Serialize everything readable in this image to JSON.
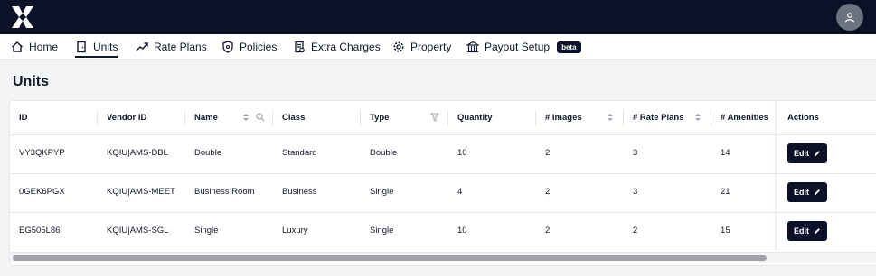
{
  "nav": {
    "items": [
      {
        "label": "Home",
        "icon": "home-icon"
      },
      {
        "label": "Units",
        "icon": "door-icon",
        "active": true
      },
      {
        "label": "Rate Plans",
        "icon": "trend-icon"
      },
      {
        "label": "Policies",
        "icon": "shield-icon"
      },
      {
        "label": "Extra Charges",
        "icon": "invoice-icon"
      },
      {
        "label": "Property",
        "icon": "gear-icon"
      },
      {
        "label": "Payout Setup",
        "icon": "bank-icon",
        "badge": "beta"
      }
    ]
  },
  "page": {
    "title": "Units"
  },
  "table": {
    "columns": [
      "ID",
      "Vendor ID",
      "Name",
      "Class",
      "Type",
      "Quantity",
      "# Images",
      "# Rate Plans",
      "# Amenities",
      "Actions"
    ],
    "rows": [
      {
        "id": "VY3QKPYP",
        "vendor_id": "KQIU|AMS-DBL",
        "name": "Double",
        "class": "Standard",
        "type": "Double",
        "quantity": "10",
        "images": "2",
        "rate_plans": "3",
        "amenities": "14"
      },
      {
        "id": "0GEK6PGX",
        "vendor_id": "KQIU|AMS-MEET",
        "name": "Business Room",
        "class": "Business",
        "type": "Single",
        "quantity": "4",
        "images": "2",
        "rate_plans": "3",
        "amenities": "21"
      },
      {
        "id": "EG505L86",
        "vendor_id": "KQIU|AMS-SGL",
        "name": "Single",
        "class": "Luxury",
        "type": "Single",
        "quantity": "10",
        "images": "2",
        "rate_plans": "2",
        "amenities": "15"
      }
    ],
    "edit_label": "Edit"
  },
  "colors": {
    "brand": "#0d1127",
    "border": "#e5e7eb"
  }
}
